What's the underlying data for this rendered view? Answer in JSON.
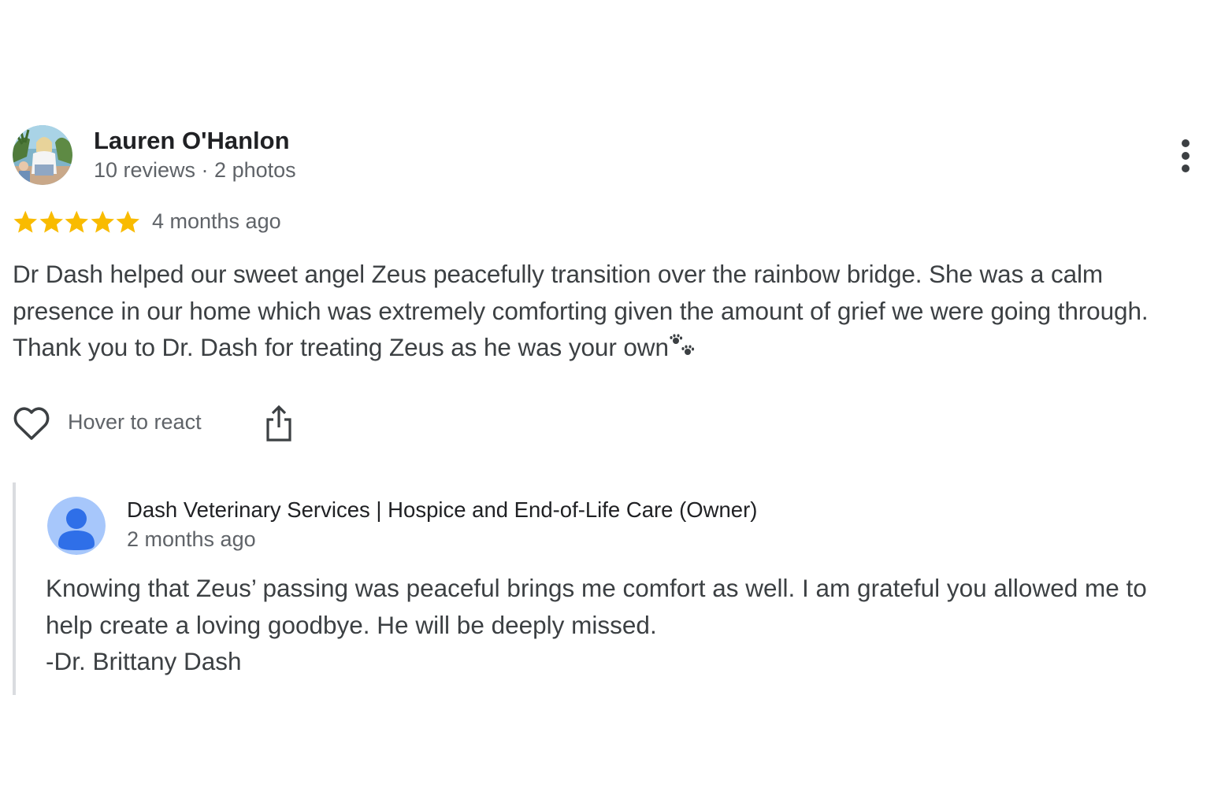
{
  "review": {
    "reviewer": {
      "name": "Lauren O'Hanlon",
      "meta": "10 reviews · 2 photos",
      "avatar_icon": "reviewer-photo"
    },
    "rating": 5,
    "rating_max": 5,
    "star_color": "#f9bb00",
    "time": "4 months ago",
    "text_lines": [
      "Dr Dash helped our sweet angel Zeus peacefully transition over the rainbow bridge. She was a calm",
      "presence in our home which was extremely comforting given the amount of grief we were going through.",
      "Thank you to Dr. Dash for treating Zeus as he was your own"
    ],
    "text_emoji_icon": "paw-prints-icon",
    "more_icon": "more-vertical-icon",
    "actions": {
      "react_icon": "heart-outline-icon",
      "react_label": "Hover to react",
      "share_icon": "share-icon"
    }
  },
  "owner_reply": {
    "name": "Dash Veterinary Services | Hospice and End-of-Life Care (Owner)",
    "time": "2 months ago",
    "avatar_icon": "default-user-avatar",
    "avatar_color": "#4285f4",
    "text_lines": [
      "Knowing that Zeus’ passing was peaceful brings me comfort as well. I am grateful you allowed me to",
      "help create a loving goodbye. He will be deeply missed.",
      "-Dr. Brittany Dash"
    ]
  }
}
